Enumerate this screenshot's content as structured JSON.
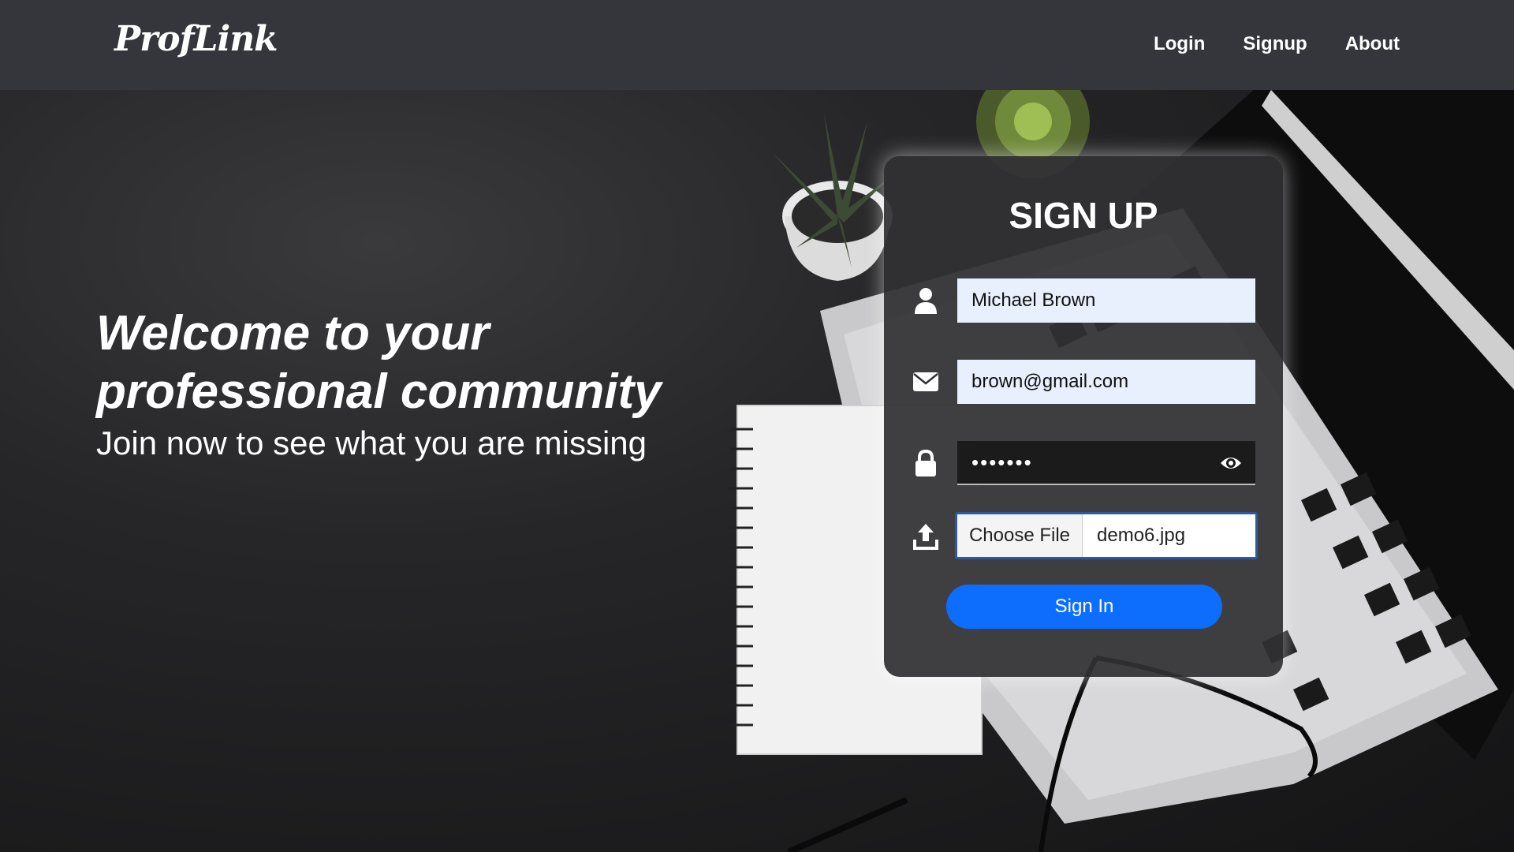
{
  "navbar": {
    "logo": "ProfLink",
    "links": [
      "Login",
      "Signup",
      "About"
    ]
  },
  "hero": {
    "title": "Welcome to your professional community",
    "subtitle": "Join now to see what you are missing"
  },
  "signup_form": {
    "title": "SIGN UP",
    "name_value": "Michael Brown",
    "email_value": "brown@gmail.com",
    "password_value": "•••••••",
    "file_button_label": "Choose File",
    "file_name": "demo6.jpg",
    "submit_label": "Sign In",
    "icons": {
      "name": "user-icon",
      "email": "envelope-icon",
      "password": "lock-icon",
      "file": "upload-icon",
      "toggle_password": "eye-icon"
    }
  },
  "colors": {
    "navbar_bg": "#34363b",
    "card_bg": "#323234",
    "input_bg": "#e8f0fe",
    "button_primary": "#0d6efd",
    "text_light": "#ffffff"
  }
}
